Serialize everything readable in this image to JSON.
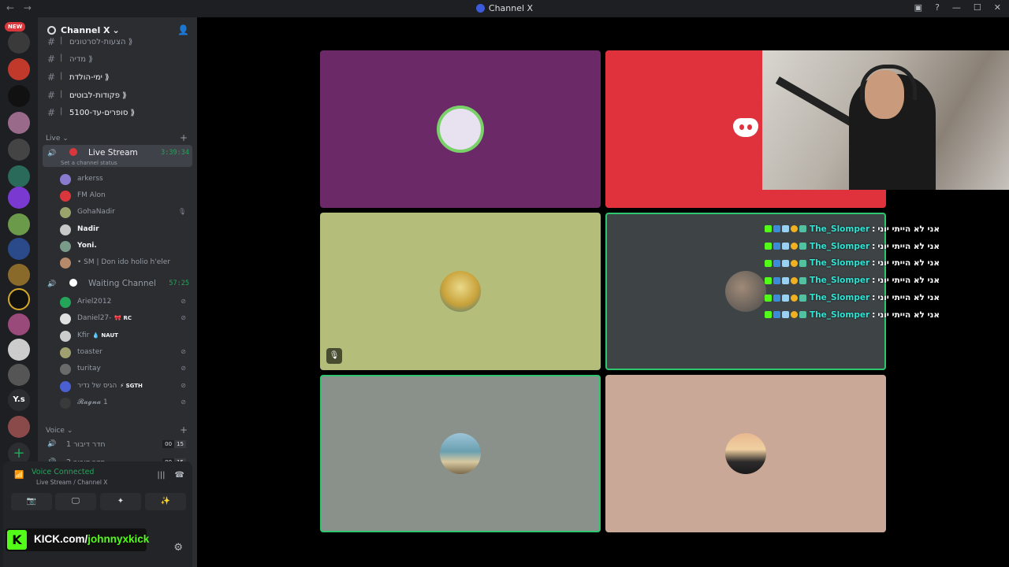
{
  "titlebar": {
    "title": "Channel X",
    "back": "←",
    "forward": "→",
    "inbox": "▣",
    "help": "?",
    "minimize": "—",
    "maximize": "☐",
    "close": "✕"
  },
  "servers": {
    "new_badge": "NEW",
    "ys_label": "Y.s",
    "add_label": "+"
  },
  "guild": {
    "name": "Channel X",
    "chevron": "⌄"
  },
  "text_channels": [
    {
      "name": "הצעות-לסרטונים ⟫"
    },
    {
      "name": "מדיה ⟫"
    },
    {
      "name": "ימי-הולדת ⟫"
    },
    {
      "name": "פקודות-לבוטים ⟫"
    },
    {
      "name": "סופרים-עד-5100 ⟫"
    }
  ],
  "categories": {
    "live": "Live",
    "voice": "Voice",
    "chev": "⌄"
  },
  "live_stream": {
    "name": "Live Stream",
    "timer": "3:39:34",
    "status": "Set a channel status",
    "members": [
      {
        "name": "arkerss",
        "color": "#8a7bd1"
      },
      {
        "name": "FM Alon",
        "color": "#da373c"
      },
      {
        "name": "GohaNadir",
        "color": "#9aa36b"
      },
      {
        "name": "Nadir",
        "color": "#c8c8c8",
        "bold": true
      },
      {
        "name": "Yoni.",
        "color": "#7a9a8a",
        "bold": true
      },
      {
        "name": "• SM | Don ido holio h'eler",
        "color": "#b48a6a"
      }
    ]
  },
  "waiting_channel": {
    "name": "Waiting Channel",
    "timer": "57:25",
    "members": [
      {
        "name": "Ariel2012",
        "color": "#23a55a",
        "tag": ""
      },
      {
        "name": "Daniel27-",
        "color": "#e0e0e0",
        "tag": "🎀 RC"
      },
      {
        "name": "Kfir",
        "color": "#cccccc",
        "tag": "💧 NAUT"
      },
      {
        "name": "toaster",
        "color": "#a0a070",
        "tag": ""
      },
      {
        "name": "turitay",
        "color": "#6a6a6a",
        "tag": ""
      },
      {
        "name": "הגיס של נדיר",
        "color": "#4a5fd1",
        "tag": "⚡ SGTH"
      },
      {
        "name": "𝓡𝓪𝓰𝓷𝓪 1",
        "color": "#3a3a3a",
        "tag": ""
      }
    ]
  },
  "voice_channels": [
    {
      "name": "חדר דיבור 1",
      "count_a": "00",
      "count_b": "15"
    },
    {
      "name": "חדר דיבור 2",
      "count_a": "00",
      "count_b": "15"
    }
  ],
  "panel": {
    "status": "Voice Connected",
    "sub": "Live Stream / Channel X",
    "btn_camera": "📷",
    "btn_screen": "🖵",
    "btn_activity": "✦",
    "btn_soundboard": "✨",
    "settings": "⚙"
  },
  "kick_overlay": {
    "prefix": "KICK.com/",
    "channel": "johnnyxkick",
    "logo": "K"
  },
  "stage": {
    "tiles": [
      {
        "bg": "#6b2a67",
        "avatar": "#e8e1f0"
      },
      {
        "bg": "#e0323c",
        "avatar": ""
      },
      {
        "bg": "#b5bd7a",
        "avatar": "#c9a23a"
      },
      {
        "bg": "#3e4446",
        "avatar": "#6b6155"
      },
      {
        "bg": "#8a918a",
        "avatar": "#c4b9a5"
      },
      {
        "bg": "#c9a898",
        "avatar": "#2d2a2a"
      }
    ],
    "mic_muted": "🎙"
  },
  "chat": {
    "user": "The_Slomper",
    "text": "אני לא הייתי יוני",
    "messages": 6
  },
  "colors": {
    "accent_green": "#23a55a",
    "kick_green": "#53fc18",
    "discord_red": "#e0323c",
    "chat_user": "#2ee6d6"
  }
}
